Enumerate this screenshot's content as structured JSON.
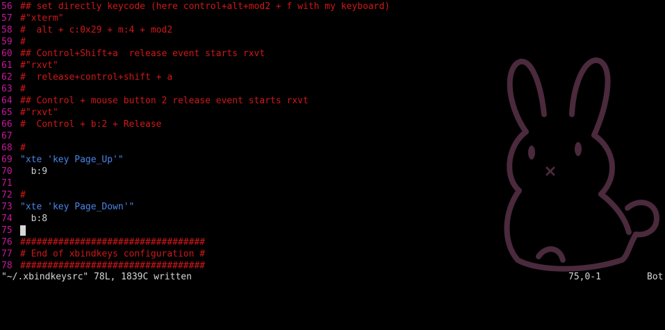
{
  "editor": {
    "lines": [
      {
        "n": "56",
        "text": "## set directly keycode (here control+alt+mod2 + f with my keyboard)",
        "kind": "comment"
      },
      {
        "n": "57",
        "text": "#\"xterm\"",
        "kind": "comment"
      },
      {
        "n": "58",
        "text": "#  alt + c:0x29 + m:4 + mod2",
        "kind": "comment"
      },
      {
        "n": "59",
        "text": "#",
        "kind": "comment"
      },
      {
        "n": "60",
        "text": "## Control+Shift+a  release event starts rxvt",
        "kind": "comment"
      },
      {
        "n": "61",
        "text": "#\"rxvt\"",
        "kind": "comment"
      },
      {
        "n": "62",
        "text": "#  release+control+shift + a",
        "kind": "comment"
      },
      {
        "n": "63",
        "text": "#",
        "kind": "comment"
      },
      {
        "n": "64",
        "text": "## Control + mouse button 2 release event starts rxvt",
        "kind": "comment"
      },
      {
        "n": "65",
        "text": "#\"rxvt\"",
        "kind": "comment"
      },
      {
        "n": "66",
        "text": "#  Control + b:2 + Release",
        "kind": "comment"
      },
      {
        "n": "67",
        "text": "",
        "kind": "plain"
      },
      {
        "n": "68",
        "text": "#",
        "kind": "comment"
      },
      {
        "n": "69",
        "text": "\"xte 'key Page_Up'\"",
        "kind": "string"
      },
      {
        "n": "70",
        "text": "  b:9",
        "kind": "plain"
      },
      {
        "n": "71",
        "text": "",
        "kind": "plain"
      },
      {
        "n": "72",
        "text": "#",
        "kind": "comment"
      },
      {
        "n": "73",
        "text": "\"xte 'key Page_Down'\"",
        "kind": "string"
      },
      {
        "n": "74",
        "text": "  b:8",
        "kind": "plain"
      },
      {
        "n": "75",
        "text": "",
        "kind": "cursor"
      },
      {
        "n": "76",
        "text": "##################################",
        "kind": "comment"
      },
      {
        "n": "77",
        "text": "# End of xbindkeys configuration #",
        "kind": "comment"
      },
      {
        "n": "78",
        "text": "##################################",
        "kind": "comment"
      }
    ]
  },
  "status": {
    "message": "\"~/.xbindkeysrc\" 78L, 1839C written",
    "position": "75,0-1",
    "scroll": "Bot"
  },
  "colors": {
    "line_number": "#c8189c",
    "comment": "#d01818",
    "string": "#4a86e8",
    "text": "#d0d0d0",
    "background": "#000000",
    "wallpaper_outline": "#4a2a3c"
  },
  "wallpaper": {
    "icon": "bunny-outline-icon"
  }
}
